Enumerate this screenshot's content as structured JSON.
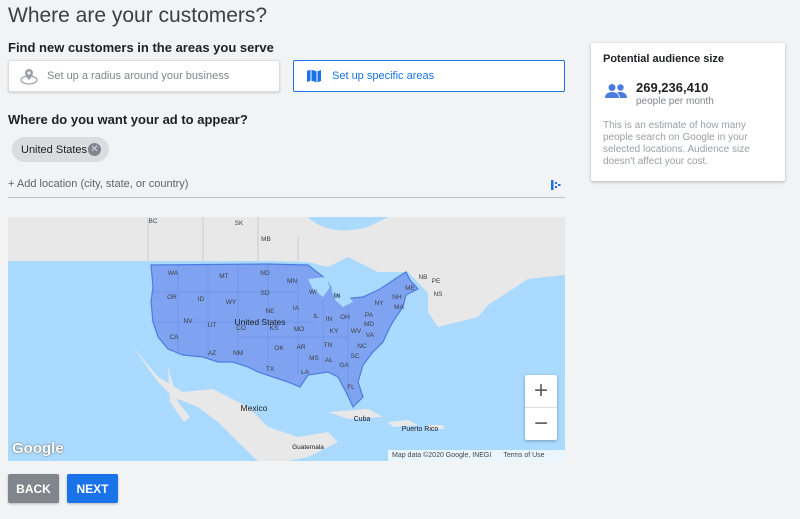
{
  "page": {
    "title": "Where are your customers?"
  },
  "areas": {
    "heading": "Find new customers in the areas you serve",
    "radius_label": "Set up a radius around your business",
    "specific_label": "Set up specific areas"
  },
  "locations": {
    "heading": "Where do you want your ad to appear?",
    "chips": [
      {
        "label": "United States"
      }
    ],
    "add_placeholder": "+ Add location (city, state, or country)"
  },
  "map": {
    "labels": {
      "bc": "BC",
      "sk": "SK",
      "mb": "MB",
      "wa": "WA",
      "mt": "MT",
      "nd": "ND",
      "mn": "MN",
      "or": "OR",
      "id": "ID",
      "wy": "WY",
      "sd": "SD",
      "wi": "WI",
      "mi": "MI",
      "ny": "NY",
      "me": "ME",
      "nb": "NB",
      "pe": "PE",
      "ns": "NS",
      "nh": "NH",
      "ma": "MA",
      "ia": "IA",
      "ne": "NE",
      "pa": "PA",
      "nv": "NV",
      "ut": "UT",
      "co": "CO",
      "ks": "KS",
      "mo": "MO",
      "il": "IL",
      "in": "IN",
      "oh": "OH",
      "md": "MD",
      "ca": "CA",
      "az": "AZ",
      "nm": "NM",
      "ok": "OK",
      "ar": "AR",
      "tn": "TN",
      "ky": "KY",
      "wv": "WV",
      "va": "VA",
      "nc": "NC",
      "sc": "SC",
      "ms": "MS",
      "al": "AL",
      "ga": "GA",
      "tx": "TX",
      "la": "LA",
      "fl": "FL",
      "us": "United States",
      "mexico": "Mexico",
      "cuba": "Cuba",
      "pr": "Puerto Rico",
      "guatemala": "Guatemala"
    },
    "zoom_in": "+",
    "zoom_out": "−",
    "attribution": "Map data ©2020 Google, INEGI",
    "terms": "Terms of Use",
    "logo": "Google"
  },
  "audience": {
    "title": "Potential audience size",
    "count": "269,236,410",
    "unit": "people per month",
    "description": "This is an estimate of how many people search on Google in your selected locations. Audience size doesn't affect your cost."
  },
  "nav": {
    "back": "BACK",
    "next": "NEXT"
  },
  "colors": {
    "accent": "#1a73e8",
    "selection": "#7fa3f0",
    "water": "#aadaff",
    "land": "#e8e8e8"
  }
}
